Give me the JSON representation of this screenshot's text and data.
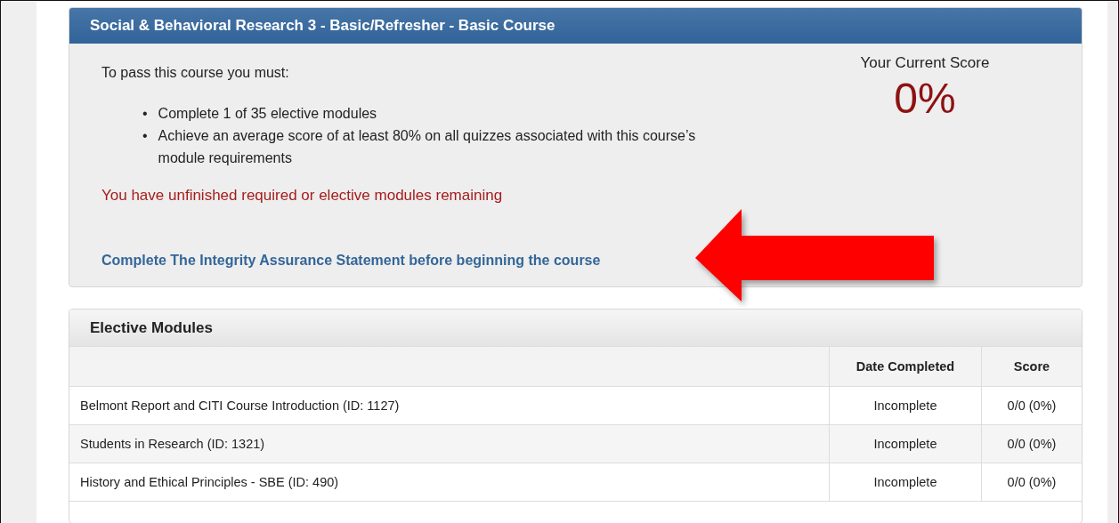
{
  "course": {
    "title": "Social & Behavioral Research 3 - Basic/Refresher - Basic Course",
    "intro": "To pass this course you must:",
    "requirements": [
      {
        "bullet": "•",
        "text": "Complete 1 of 35 elective modules"
      },
      {
        "bullet": "•",
        "text": "Achieve an average score of at least 80% on all quizzes associated with this course’s module requirements"
      }
    ],
    "warning": "You have unfinished required or elective modules remaining",
    "link": "Complete The Integrity Assurance Statement before beginning the course",
    "score_label": "Your Current Score",
    "score": "0%"
  },
  "modules": {
    "title": "Elective Modules",
    "columns": [
      "Date Completed",
      "Score"
    ],
    "rows": [
      {
        "name": "Belmont Report and CITI Course Introduction (ID: 1127)",
        "date": "Incomplete",
        "score": "0/0 (0%)"
      },
      {
        "name": "Students in Research (ID: 1321)",
        "date": "Incomplete",
        "score": "0/0 (0%)"
      },
      {
        "name": "History and Ethical Principles - SBE (ID: 490)",
        "date": "Incomplete",
        "score": "0/0 (0%)"
      }
    ]
  }
}
